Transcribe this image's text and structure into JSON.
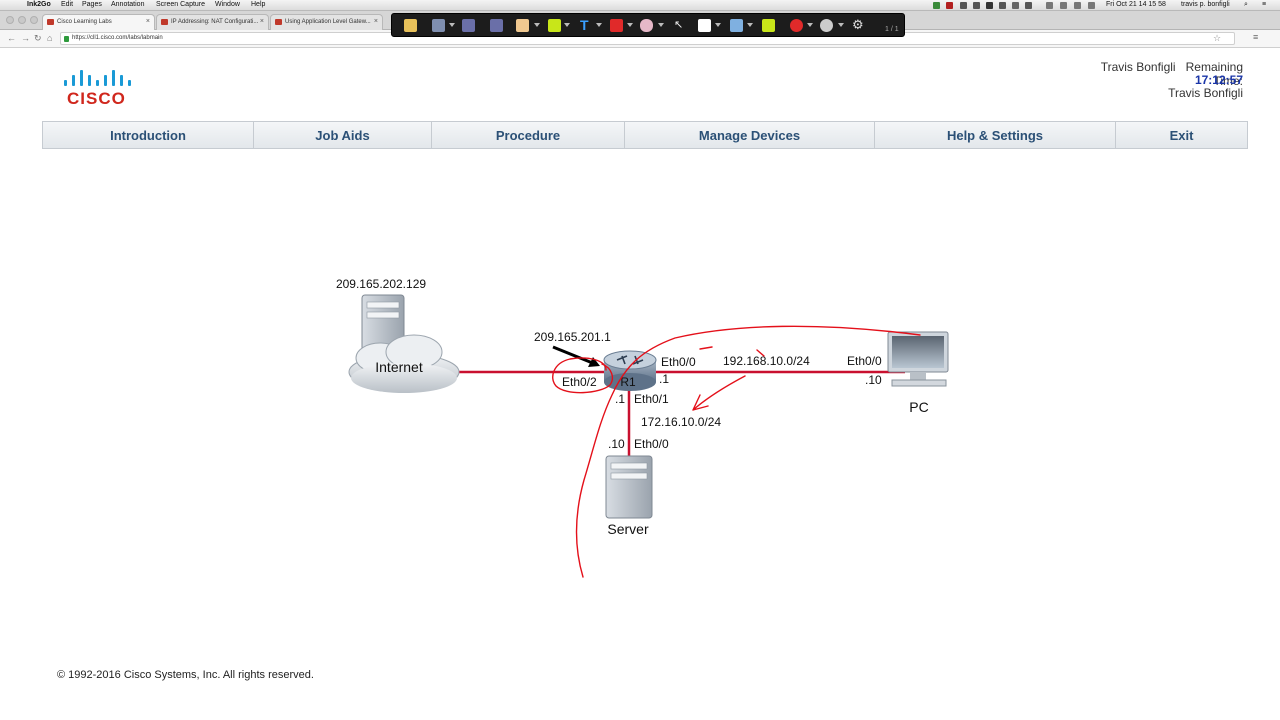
{
  "menubar": {
    "app": "Ink2Go",
    "items": [
      "Edit",
      "Pages",
      "Annotation",
      "Screen Capture",
      "Window",
      "Help"
    ],
    "clock": "Fri Oct 21  14 15 58",
    "user": "travis p. bonfigli"
  },
  "browser": {
    "tabs": [
      {
        "title": "Cisco Learning Labs"
      },
      {
        "title": "IP Addressing: NAT Configurati..."
      },
      {
        "title": "Using Application Level Gatew..."
      }
    ],
    "url": "https://cll1.cisco.com/labs/labmain"
  },
  "toolbar": {
    "page_indicator": "1 / 1",
    "colors": {
      "highlighter": "#c8e619",
      "shape": "#e02a2a",
      "accent": "#2c8ee0"
    }
  },
  "header": {
    "logo_text": "CISCO",
    "user_name": "Travis Bonfigli",
    "remaining_label": "Remaining Time:",
    "remaining_time": "17:12:57",
    "user_name_2": "Travis Bonfigli"
  },
  "nav": {
    "tabs": [
      "Introduction",
      "Job Aids",
      "Procedure",
      "Manage Devices",
      "Help & Settings",
      "Exit"
    ]
  },
  "topology": {
    "internet_server_ip": "209.165.202.129",
    "internet_label": "Internet",
    "r1_outside_ip": "209.165.201.1",
    "router_name": "R1",
    "r1_eth0_2": "Eth0/2",
    "r1_eth0_0": "Eth0/0",
    "r1_eth0_0_host": ".1",
    "r1_eth0_1": "Eth0/1",
    "r1_eth0_1_host": ".1",
    "lan_pc_subnet": "192.168.10.0/24",
    "lan_server_subnet": "172.16.10.0/24",
    "pc_iface": "Eth0/0",
    "pc_host": ".10",
    "pc_label": "PC",
    "server_iface": "Eth0/0",
    "server_host": ".10",
    "server_label": "Server",
    "link_color": "#c9102f",
    "annotation_color": "#e4101a"
  },
  "footer": {
    "copyright": "© 1992-2016 Cisco Systems, Inc. All rights reserved."
  }
}
